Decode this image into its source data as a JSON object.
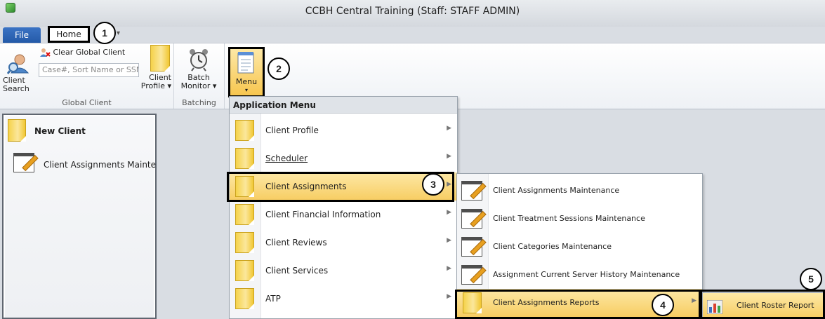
{
  "window": {
    "title": "CCBH Central Training (Staff: STAFF ADMIN)"
  },
  "tabs": {
    "file": "File",
    "home": "Home"
  },
  "ribbon": {
    "global_client": {
      "client_search": "Client\nSearch",
      "clear_global_client": "Clear Global Client",
      "search_placeholder": "Case#, Sort Name or SSN",
      "client_profile": "Client\nProfile ▾",
      "group_label": "Global Client"
    },
    "batching": {
      "batch_monitor": "Batch\nMonitor ▾",
      "group_label": "Batching"
    },
    "menu": {
      "label": "Menu"
    }
  },
  "left_pane": {
    "new_client": "New Client",
    "item": "Client Assignments Mainte"
  },
  "app_menu": {
    "header": "Application Menu",
    "items": [
      {
        "label": "Client Profile"
      },
      {
        "label": "Scheduler"
      },
      {
        "label": "Client Assignments"
      },
      {
        "label": "Client Financial Information"
      },
      {
        "label": "Client Reviews"
      },
      {
        "label": "Client Services"
      },
      {
        "label": "ATP"
      }
    ]
  },
  "submenu": {
    "items": [
      {
        "label": "Client Assignments Maintenance"
      },
      {
        "label": "Client Treatment Sessions Maintenance"
      },
      {
        "label": "Client Categories Maintenance"
      },
      {
        "label": "Assignment Current Server History Maintenance"
      },
      {
        "label": "Client Assignments Reports"
      }
    ]
  },
  "subsubmenu": {
    "item": "Client Roster Report"
  },
  "callouts": [
    "1",
    "2",
    "3",
    "4",
    "5"
  ],
  "colors": {
    "accent_tab": "#2f66b7",
    "highlight": "#f7cd62"
  }
}
